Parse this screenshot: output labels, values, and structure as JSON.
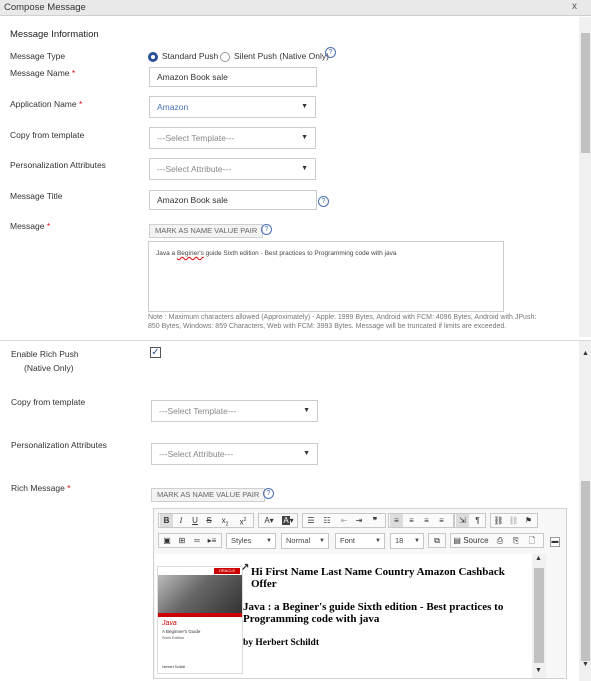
{
  "window": {
    "title": "Compose Message",
    "close": "x"
  },
  "section1": {
    "heading": "Message Information",
    "message_type": {
      "label": "Message Type",
      "option1": "Standard Push",
      "option2": "Silent Push (Native Only)"
    },
    "message_name": {
      "label": "Message Name",
      "value": "Amazon Book sale"
    },
    "application_name": {
      "label": "Application Name",
      "value": "Amazon"
    },
    "copy_template": {
      "label": "Copy from template",
      "value": "---Select Template---"
    },
    "personalization": {
      "label": "Personalization Attributes",
      "value": "---Select Attribute---"
    },
    "message_title": {
      "label": "Message Title",
      "value": "Amazon Book sale"
    },
    "message": {
      "label": "Message",
      "button": "MARK AS NAME VALUE PAIR",
      "text_prefix": "Java a ",
      "text_misspelled": "Beginer's",
      "text_suffix": " guide Sixth edition - Best practices to Programming code with java",
      "note": "Note : Maximum characters allowed (Approximately) - Apple: 1999 Bytes, Android with FCM: 4096 Bytes, Android with JPush: 850 Bytes, Windows: 859 Characters, Web with FCM: 3993 Bytes. Message will be truncated if limits are exceeded."
    }
  },
  "section2": {
    "rich_push": {
      "label": "Enable Rich Push",
      "sublabel": "(Native Only)"
    },
    "copy_template": {
      "label": "Copy from template",
      "value": "---Select Template---"
    },
    "personalization": {
      "label": "Personalization Attributes",
      "value": "---Select Attribute---"
    },
    "rich_message": {
      "label": "Rich Message",
      "button": "MARK AS NAME VALUE PAIR",
      "toolbar": {
        "styles": "Styles",
        "format": "Normal",
        "font": "Font",
        "size": "18",
        "source": "Source"
      },
      "content": {
        "line1": "Hi First Name Last Name Country  Amazon  Cashback Offer",
        "line2": "Java : a Beginer's guide Sixth edition - Best practices to Programming  code with java",
        "line3": "by Herbert Schildt"
      },
      "book_cover": {
        "brand": "ORACLE",
        "title1": "Java",
        "title2": "A Beginner's Guide",
        "edition": "Sixth Edition",
        "author": "Herbert Schildt"
      }
    }
  },
  "colors": {
    "accent": "#2a4f9b",
    "required": "#dd0000"
  }
}
